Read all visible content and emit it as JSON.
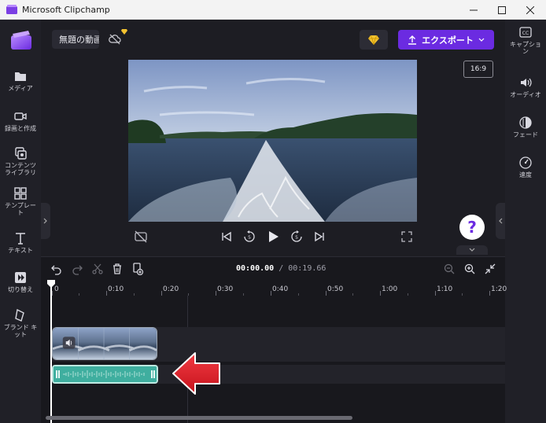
{
  "window": {
    "title": "Microsoft Clipchamp"
  },
  "header": {
    "project_name": "無題の動画",
    "export_label": "エクスポート",
    "aspect_ratio": "16:9"
  },
  "left_nav": {
    "items": [
      {
        "label": "メディア",
        "icon": "folder-icon"
      },
      {
        "label": "録画と作成",
        "icon": "camera-icon"
      },
      {
        "label": "コンテンツ\nライブラリ",
        "icon": "library-icon"
      },
      {
        "label": "テンプレー\nト",
        "icon": "template-icon"
      },
      {
        "label": "テキスト",
        "icon": "text-icon"
      },
      {
        "label": "切り替え",
        "icon": "transition-icon"
      },
      {
        "label": "ブランド キ\nット",
        "icon": "brand-kit-icon"
      }
    ]
  },
  "right_nav": {
    "items": [
      {
        "label": "キャプショ\nン",
        "icon": "captions-icon"
      },
      {
        "label": "オーディオ",
        "icon": "speaker-icon"
      },
      {
        "label": "フェード",
        "icon": "fade-icon"
      },
      {
        "label": "速度",
        "icon": "speed-icon"
      }
    ]
  },
  "player": {
    "help_label": "?"
  },
  "timeline": {
    "current_time": "00:00.00",
    "total_time": "/ 00:19.66",
    "ruler_labels": [
      "0",
      "0:10",
      "0:20",
      "0:30",
      "0:40",
      "0:50",
      "1:00",
      "1:10",
      "1:20"
    ]
  },
  "colors": {
    "accent": "#6b2be1",
    "audio_clip": "#3fae9f",
    "arrow": "#e0262f"
  }
}
